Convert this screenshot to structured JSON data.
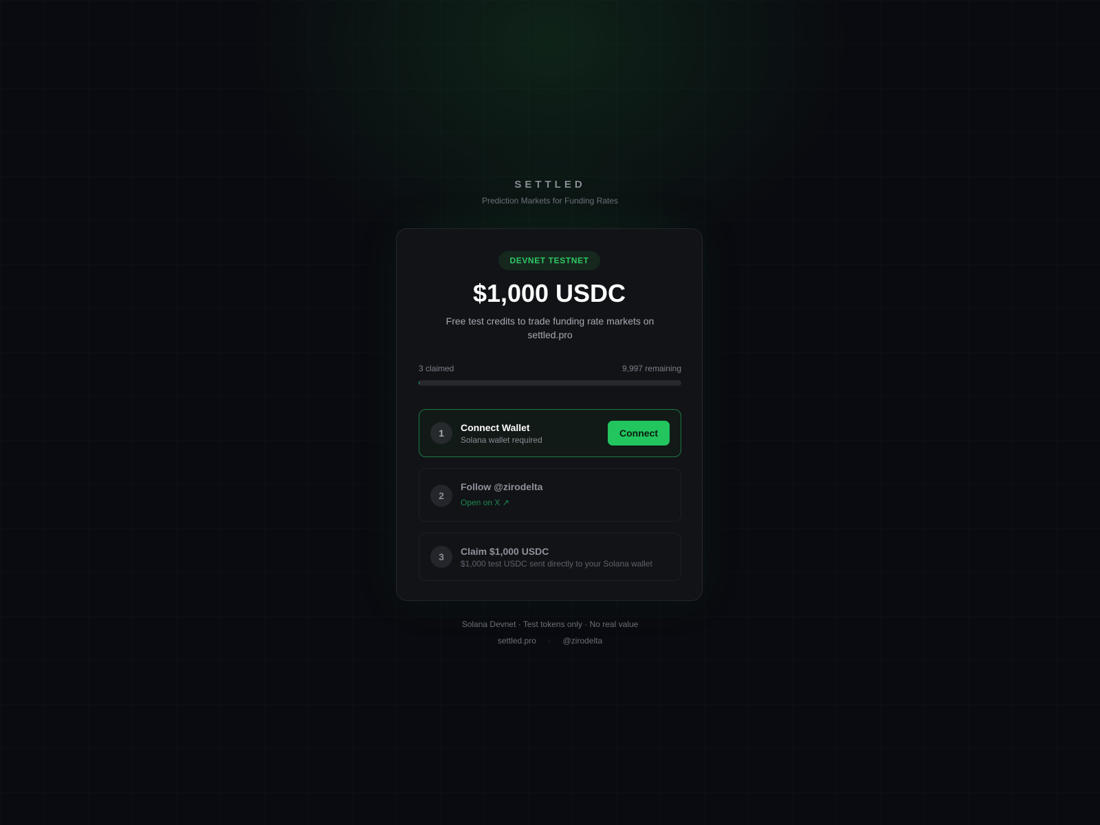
{
  "brand": {
    "name": "SETTLED",
    "tagline": "Prediction Markets for Funding Rates"
  },
  "card": {
    "badge": "DEVNET TESTNET",
    "amount": "$1,000 USDC",
    "subtitle": "Free test credits to trade funding rate markets on settled.pro",
    "progress": {
      "claimed_label": "3 claimed",
      "remaining_label": "9,997 remaining",
      "claimed": 3,
      "total": 10000
    },
    "steps": [
      {
        "number": "1",
        "title": "Connect Wallet",
        "desc": "Solana wallet required",
        "button_label": "Connect"
      },
      {
        "number": "2",
        "title": "Follow @zirodelta",
        "link_label": "Open on X ↗"
      },
      {
        "number": "3",
        "title": "Claim $1,000 USDC",
        "desc": "$1,000 test USDC sent directly to your Solana wallet"
      }
    ]
  },
  "footer": {
    "note": "Solana Devnet · Test tokens only · No real value",
    "links": [
      "settled.pro",
      "@zirodelta"
    ],
    "separator": "·"
  },
  "colors": {
    "accent": "#22c55e",
    "background": "#0a0b10",
    "card": "#111317"
  }
}
